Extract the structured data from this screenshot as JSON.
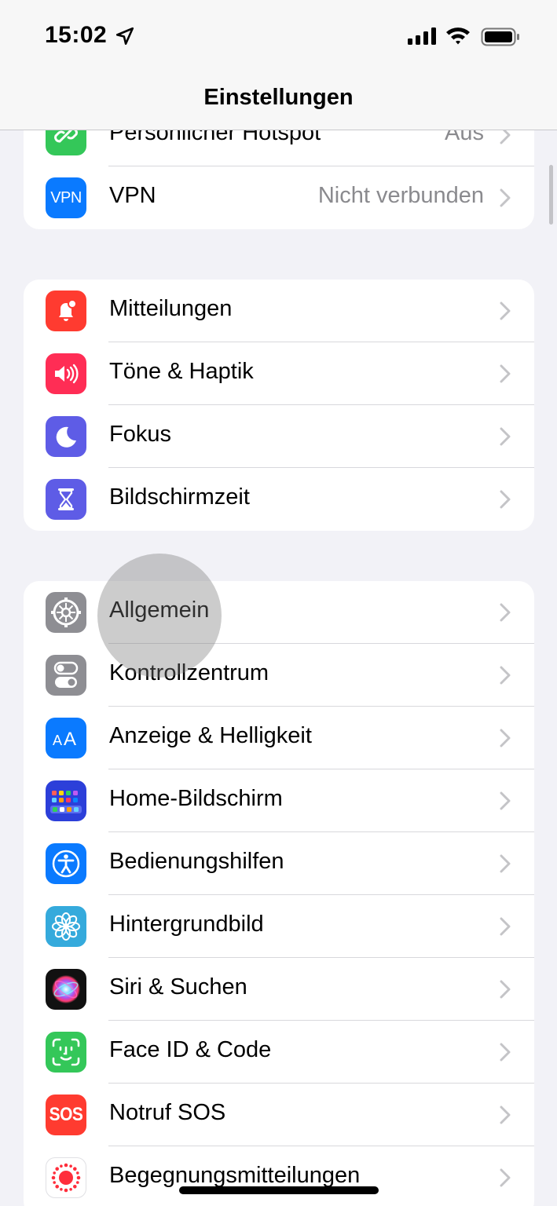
{
  "status": {
    "time": "15:02",
    "location_icon": "location-arrow-icon",
    "signal_icon": "cellular-signal-icon",
    "wifi_icon": "wifi-icon",
    "battery_icon": "battery-icon"
  },
  "nav": {
    "title": "Einstellungen"
  },
  "groups": [
    {
      "items": [
        {
          "label": "Persönlicher Hotspot",
          "value": "Aus",
          "icon": "hotspot-icon",
          "color": "#34c759"
        },
        {
          "label": "VPN",
          "value": "Nicht verbunden",
          "icon": "vpn-icon",
          "color": "#0a7aff"
        }
      ]
    },
    {
      "items": [
        {
          "label": "Mitteilungen",
          "icon": "bell-icon",
          "color": "#ff3b30"
        },
        {
          "label": "Töne & Haptik",
          "icon": "speaker-icon",
          "color": "#ff2d55"
        },
        {
          "label": "Fokus",
          "icon": "moon-icon",
          "color": "#5e5ce6"
        },
        {
          "label": "Bildschirmzeit",
          "icon": "hourglass-icon",
          "color": "#5e5ce6"
        }
      ]
    },
    {
      "items": [
        {
          "label": "Allgemein",
          "icon": "gear-icon",
          "color": "#8e8e93"
        },
        {
          "label": "Kontrollzentrum",
          "icon": "toggle-icon",
          "color": "#8e8e93"
        },
        {
          "label": "Anzeige & Helligkeit",
          "icon": "text-size-icon",
          "color": "#0a7aff"
        },
        {
          "label": "Home-Bildschirm",
          "icon": "app-grid-icon",
          "color": "#2c3fd9"
        },
        {
          "label": "Bedienungshilfen",
          "icon": "accessibility-icon",
          "color": "#0a7aff"
        },
        {
          "label": "Hintergrundbild",
          "icon": "flower-icon",
          "color": "#35aadc"
        },
        {
          "label": "Siri & Suchen",
          "icon": "siri-icon",
          "color": "#111111"
        },
        {
          "label": "Face ID & Code",
          "icon": "face-id-icon",
          "color": "#34c759"
        },
        {
          "label": "Notruf SOS",
          "icon": "sos-icon",
          "color": "#ff3b30",
          "icon_text": "SOS"
        },
        {
          "label": "Begegnungsmitteilungen",
          "icon": "exposure-icon",
          "color": "#ffffff"
        }
      ]
    }
  ]
}
